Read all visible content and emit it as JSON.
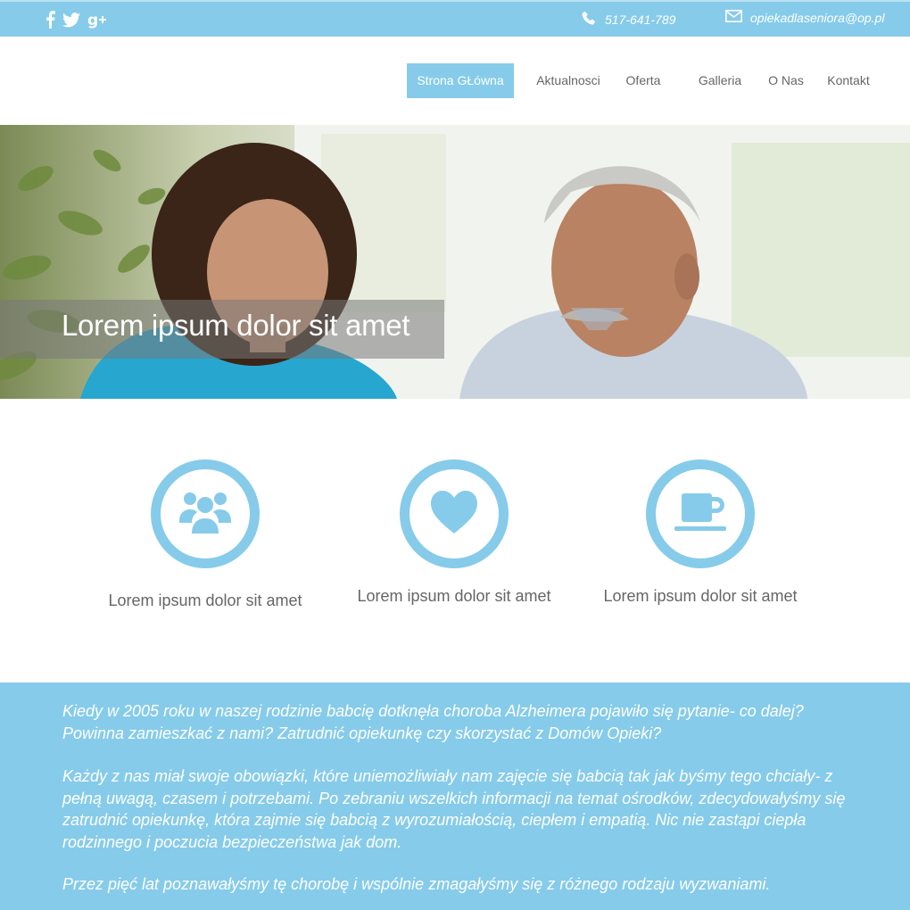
{
  "topbar": {
    "social": [
      {
        "name": "facebook-icon"
      },
      {
        "name": "twitter-icon"
      },
      {
        "name": "google-plus-icon"
      }
    ],
    "phone": "517-641-789",
    "email": "opiekadlaseniora@op.pl"
  },
  "nav": {
    "items": [
      {
        "label": "Strona GŁówna",
        "active": true
      },
      {
        "label": "Aktualnosci"
      },
      {
        "label": "Oferta"
      },
      {
        "label": "Galleria"
      },
      {
        "label": "O Nas"
      },
      {
        "label": "Kontakt"
      }
    ]
  },
  "hero": {
    "caption": "Lorem ipsum dolor sit amet"
  },
  "features": [
    {
      "icon": "users-icon",
      "label": "Lorem ipsum dolor sit amet"
    },
    {
      "icon": "heart-icon",
      "label": "Lorem ipsum dolor sit amet"
    },
    {
      "icon": "coffee-cup-icon",
      "label": "Lorem ipsum dolor sit amet"
    }
  ],
  "story": {
    "paragraphs": [
      "Kiedy w 2005 roku w naszej rodzinie babcię dotknęła choroba Alzheimera pojawiło się pytanie- co dalej? Powinna zamieszkać z nami? Zatrudnić opiekunkę czy skorzystać z Domów Opieki?",
      "Każdy z nas miał swoje obowiązki, które uniemożliwiały nam zajęcie się babcią tak jak byśmy tego chciały- z pełną uwagą, czasem i potrzebami. Po zebraniu wszelkich informacji na temat ośrodków, zdecydowałyśmy się zatrudnić opiekunkę, która zajmie się babcią z wyrozumiałością, ciepłem i empatią. Nic nie zastąpi ciepła rodzinnego i poczucia bezpieczeństwa jak dom.",
      "Przez pięć lat poznawałyśmy tę chorobę i wspólnie zmagałyśmy się z różnego rodzaju wyzwaniami."
    ]
  },
  "colors": {
    "accent": "#86cbea",
    "text": "#666666",
    "white": "#ffffff"
  }
}
